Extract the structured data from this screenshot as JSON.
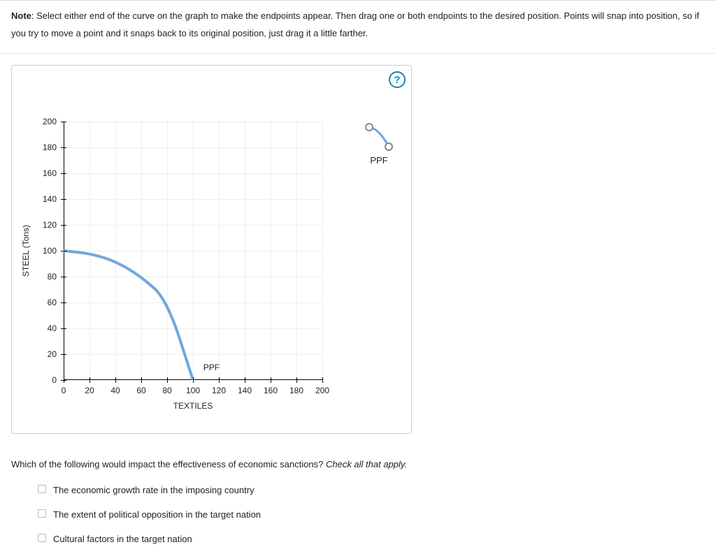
{
  "note": {
    "label": "Note",
    "text": ": Select either end of the curve on the graph to make the endpoints appear. Then drag one or both endpoints to the desired position. Points will snap into position, so if you try to move a point and it snaps back to its original position, just drag it a little farther."
  },
  "help_label": "?",
  "chart_data": {
    "type": "line",
    "title": "",
    "xlabel": "TEXTILES",
    "ylabel": "STEEL (Tons)",
    "xlim": [
      0,
      200
    ],
    "ylim": [
      0,
      200
    ],
    "x_ticks": [
      0,
      20,
      40,
      60,
      80,
      100,
      120,
      140,
      160,
      180,
      200
    ],
    "y_ticks": [
      0,
      20,
      40,
      60,
      80,
      100,
      120,
      140,
      160,
      180,
      200
    ],
    "grid": true,
    "series": [
      {
        "name": "PPF",
        "color": "#6fa8dc",
        "x": [
          0,
          20,
          40,
          60,
          80,
          100
        ],
        "y": [
          100,
          98,
          92,
          80,
          62,
          0
        ]
      }
    ],
    "inline_label": {
      "text": "PPF",
      "x": 108,
      "y": 6
    },
    "legend": {
      "position": "right",
      "items": [
        "PPF"
      ]
    }
  },
  "question": {
    "text": "Which of the following would impact the effectiveness of economic sanctions?",
    "instruction": "Check all that apply.",
    "options": [
      "The economic growth rate in the imposing country",
      "The extent of political opposition in the target nation",
      "Cultural factors in the target nation"
    ]
  }
}
